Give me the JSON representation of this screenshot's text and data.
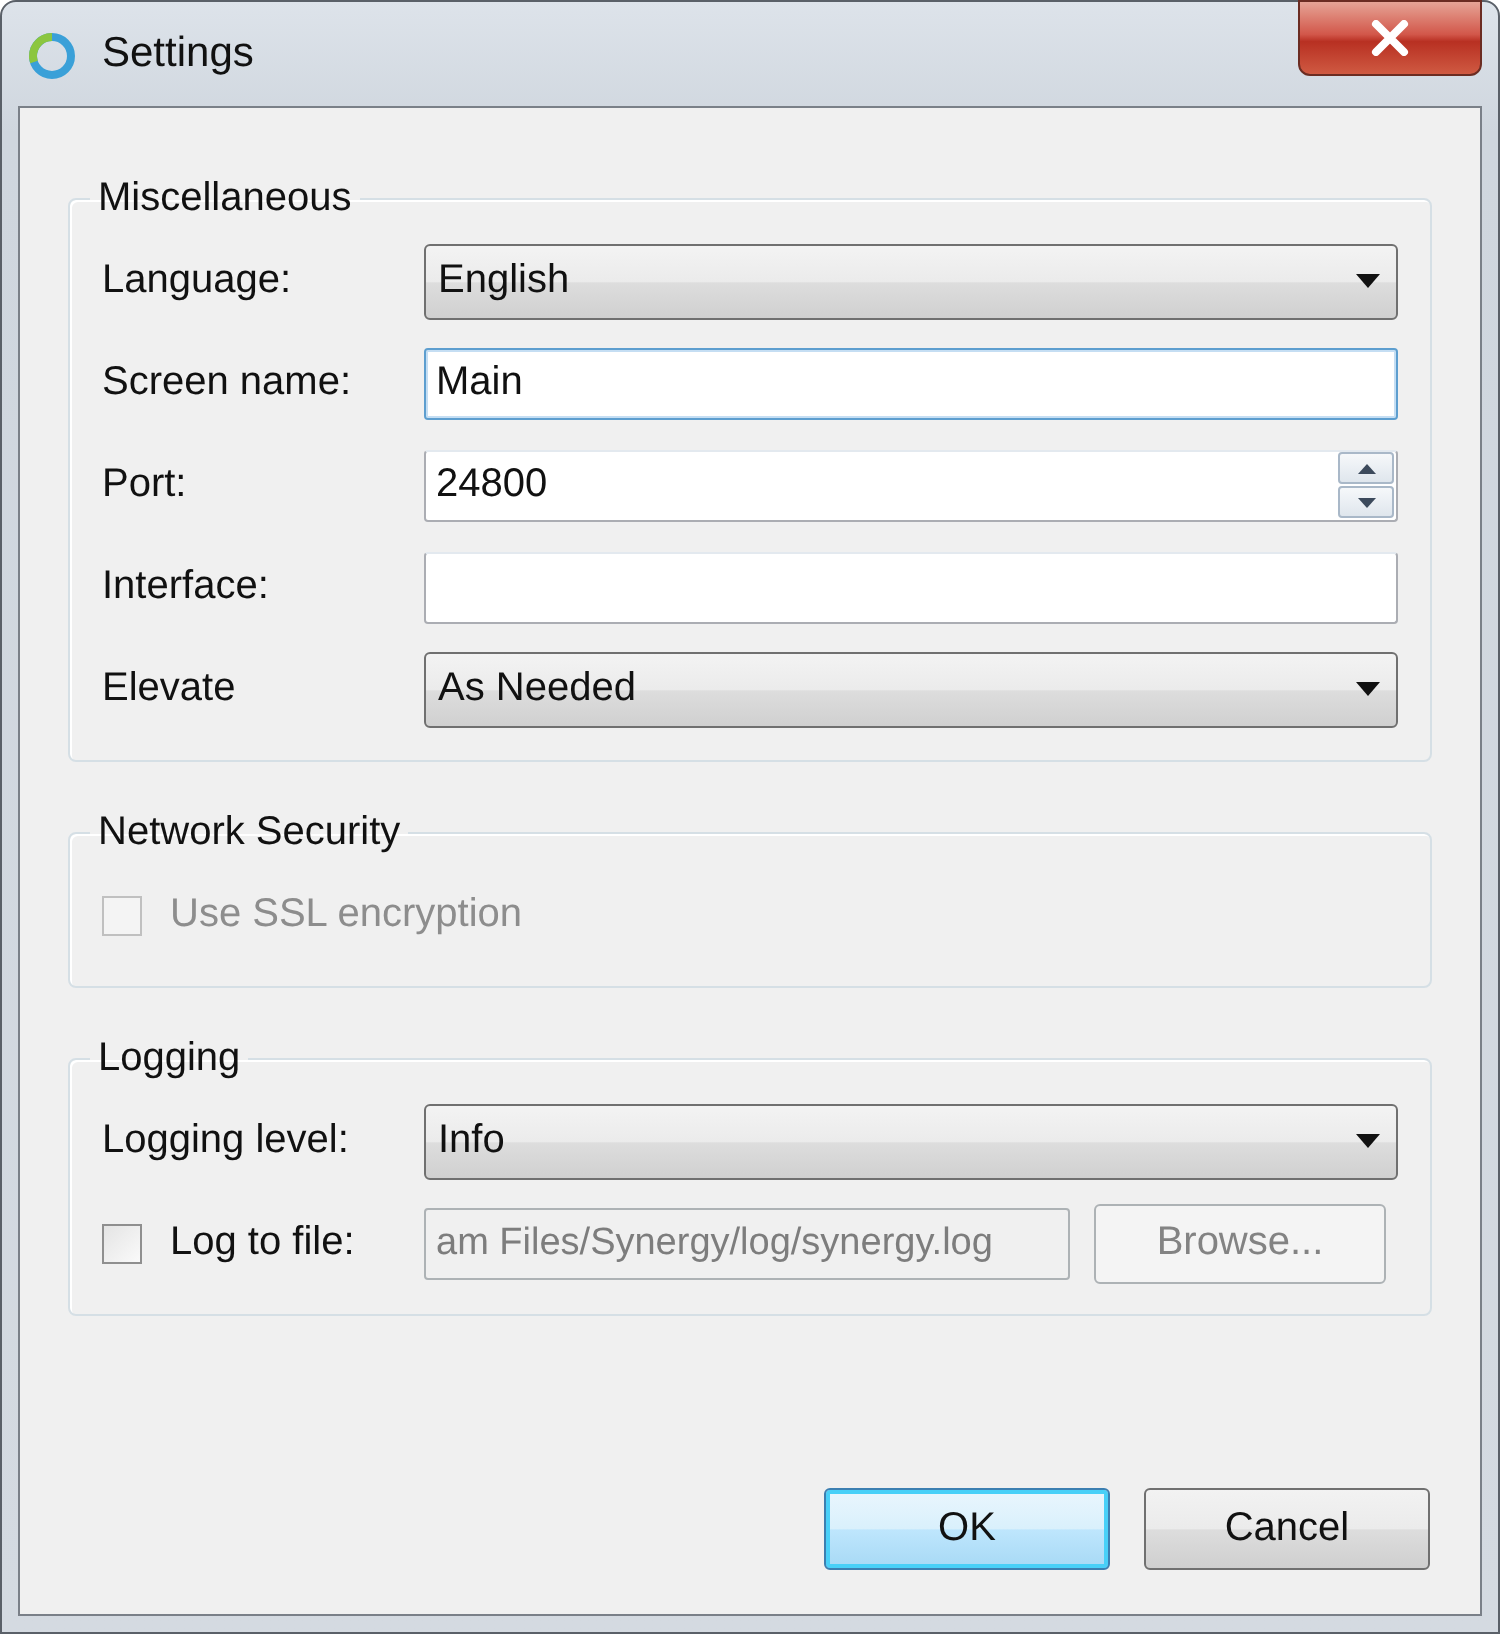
{
  "window": {
    "title": "Settings"
  },
  "groups": [
    {
      "title": "Miscellaneous",
      "rows": [
        {
          "kind": "combo",
          "label": "Language:",
          "value": "English"
        },
        {
          "kind": "text",
          "label": "Screen name:",
          "value": "Main",
          "focused": true
        },
        {
          "kind": "spin",
          "label": "Port:",
          "value": "24800"
        },
        {
          "kind": "text",
          "label": "Interface:",
          "focused": false
        },
        {
          "kind": "combo",
          "label": "Elevate",
          "value": "As Needed"
        }
      ]
    },
    {
      "title": "Network Security",
      "rows": [
        {
          "kind": "checkbox",
          "label": "Use SSL encryption",
          "checked": false,
          "disabled": true
        }
      ]
    },
    {
      "title": "Logging",
      "rows": [
        {
          "kind": "combo",
          "label": "Logging level:",
          "value": "Info"
        },
        {
          "kind": "filecheck",
          "label": "Log to file:",
          "checked": false,
          "value": "am Files/Synergy/log/synergy.log",
          "button": "Browse...",
          "disabled": true
        }
      ]
    }
  ],
  "buttons": [
    {
      "label": "OK",
      "default": true
    },
    {
      "label": "Cancel",
      "default": false
    }
  ]
}
